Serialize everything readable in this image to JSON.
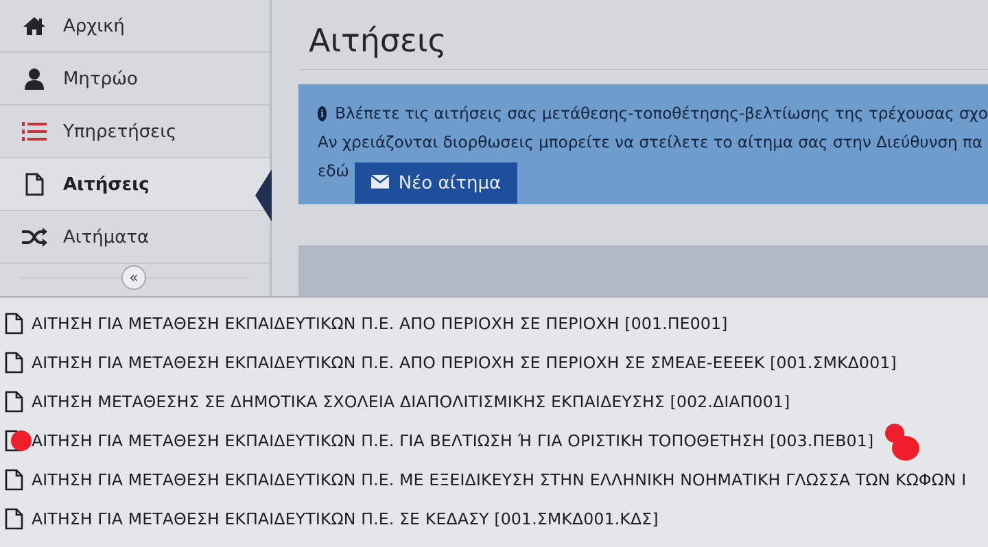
{
  "sidebar": {
    "items": [
      {
        "label": "Αρχική",
        "icon": "home-icon"
      },
      {
        "label": "Μητρώο",
        "icon": "user-icon"
      },
      {
        "label": "Υπηρετήσεις",
        "icon": "numbered-list-icon"
      },
      {
        "label": "Αιτήσεις",
        "icon": "document-icon",
        "active": true
      },
      {
        "label": "Αιτήματα",
        "icon": "shuffle-icon"
      }
    ],
    "collapse_label": "«"
  },
  "main": {
    "title": "Αιτήσεις",
    "info": {
      "line1": "Βλέπετε τις αιτήσεις σας μετάθεσης-τοποθέτησης-βελτίωσης της τρέχουσας σχο",
      "line2": "Αν χρειάζονται διορθωσεις μπορείτε να στείλετε το αίτημα σας στην Διεύθυνση πα",
      "line3_prefix": "εδώ",
      "button_label": "Νέο αίτημα"
    }
  },
  "dropdown": {
    "items": [
      "ΑΙΤΗΣΗ ΓΙΑ ΜΕΤΑΘΕΣΗ ΕΚΠΑΙΔΕΥΤΙΚΩΝ Π.Ε. ΑΠΟ ΠΕΡΙΟΧΗ ΣΕ ΠΕΡΙΟΧΗ [001.ΠΕ001]",
      "ΑΙΤΗΣΗ ΓΙΑ ΜΕΤΑΘΕΣΗ ΕΚΠΑΙΔΕΥΤΙΚΩΝ Π.Ε. ΑΠΟ ΠΕΡΙΟΧΗ ΣΕ ΠΕΡΙΟΧΗ ΣΕ ΣΜΕΑΕ-ΕΕΕΕΚ [001.ΣΜΚΔ001]",
      "ΑΙΤΗΣΗ ΜΕΤΑΘΕΣΗΣ ΣΕ ΔΗΜΟΤΙΚΑ ΣΧΟΛΕΙΑ ΔΙΑΠΟΛΙΤΙΣΜΙΚΗΣ ΕΚΠΑΙΔΕΥΣΗΣ [002.ΔΙΑΠ001]",
      "ΑΙΤΗΣΗ ΓΙΑ ΜΕΤΑΘΕΣΗ ΕΚΠΑΙΔΕΥΤΙΚΩΝ Π.Ε. ΓΙΑ ΒΕΛΤΙΩΣΗ Ή ΓΙΑ ΟΡΙΣΤΙΚΗ ΤΟΠΟΘΕΤΗΣΗ [003.ΠΕΒ01]",
      "ΑΙΤΗΣΗ ΓΙΑ ΜΕΤΑΘΕΣΗ ΕΚΠΑΙΔΕΥΤΙΚΩΝ Π.Ε. ΜΕ ΕΞΕΙΔΙΚΕΥΣΗ ΣΤΗΝ ΕΛΛΗΝΙΚΗ ΝΟΗΜΑΤΙΚΗ ΓΛΩΣΣΑ ΤΩΝ ΚΩΦΩΝ Ι",
      "ΑΙΤΗΣΗ ΓΙΑ ΜΕΤΑΘΕΣΗ ΕΚΠΑΙΔΕΥΤΙΚΩΝ Π.Ε. ΣΕ ΚΕΔΑΣΥ [001.ΣΜΚΔ001.ΚΔΣ]"
    ]
  },
  "colors": {
    "info_bg": "#6d9ccd",
    "button_bg": "#1d4f9d",
    "active_pointer": "#21304f",
    "markup_red": "#ee1f2a"
  }
}
